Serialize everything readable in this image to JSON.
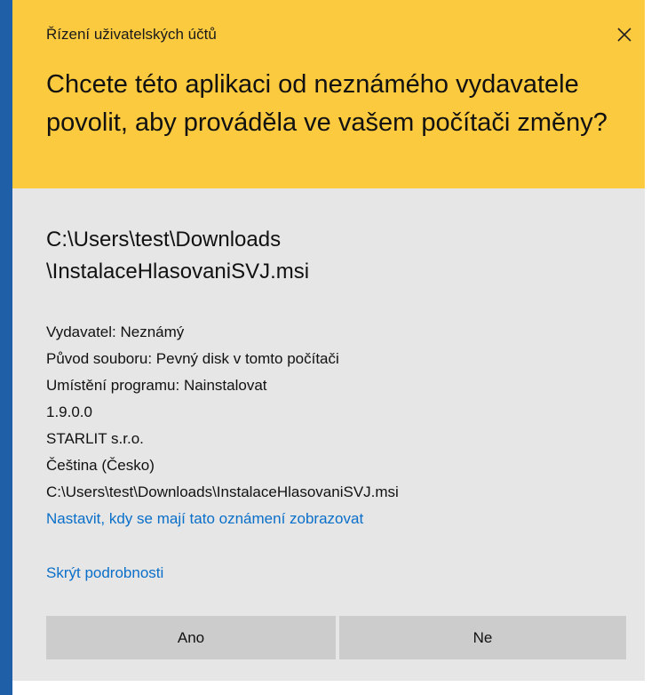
{
  "window": {
    "title": "Řízení uživatelských účtů",
    "close_icon": "close-icon"
  },
  "colors": {
    "header_bg": "#fcca3f",
    "panel_bg": "#e6e6e6",
    "accent_edge": "#1f5fa8",
    "link": "#0a6fc9",
    "button_bg": "#cccccc"
  },
  "prompt": {
    "question": "Chcete této aplikaci od neznámého vydavatele povolit, aby prováděla ve vašem počítači změny?"
  },
  "program": {
    "path_line1": "C:\\Users\\test\\Downloads",
    "path_line2": "\\InstalaceHlasovaniSVJ.msi"
  },
  "details": {
    "publisher": "Vydavatel: Neznámý",
    "file_origin": "Původ souboru: Pevný disk v tomto počítači",
    "program_location": "Umístění programu: Nainstalovat",
    "version": "1.9.0.0",
    "company": "STARLIT s.r.o.",
    "language": "Čeština (Česko)",
    "full_path": "C:\\Users\\test\\Downloads\\InstalaceHlasovaniSVJ.msi"
  },
  "links": {
    "notification_settings": "Nastavit, kdy se mají tato oznámení zobrazovat",
    "hide_details": "Skrýt podrobnosti"
  },
  "buttons": {
    "yes": "Ano",
    "no": "Ne"
  }
}
